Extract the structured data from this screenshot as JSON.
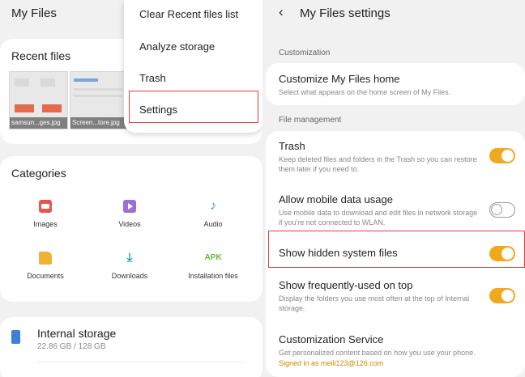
{
  "colors": {
    "accent": "#f2a81d",
    "highlight_box": "#d9403a",
    "link": "#c98a06"
  },
  "left": {
    "title": "My Files",
    "recent": {
      "title": "Recent files",
      "files": [
        "samsun...ges.jpg",
        "Screen...tore.jpg"
      ]
    },
    "menu": {
      "items": [
        "Clear Recent files list",
        "Analyze storage",
        "Trash",
        "Settings"
      ]
    },
    "categories": {
      "title": "Categories",
      "items": [
        {
          "label": "Images",
          "icon": "image-icon"
        },
        {
          "label": "Videos",
          "icon": "video-icon"
        },
        {
          "label": "Audio",
          "icon": "music-note-icon"
        },
        {
          "label": "Documents",
          "icon": "document-icon"
        },
        {
          "label": "Downloads",
          "icon": "download-icon"
        },
        {
          "label": "Installation files",
          "icon": "apk-icon",
          "icon_text": "APK"
        }
      ]
    },
    "storage": {
      "name": "Internal storage",
      "size": "22.86 GB / 128 GB"
    }
  },
  "right": {
    "title": "My Files settings",
    "sections": {
      "customization": "Customization",
      "file_management": "File management"
    },
    "customize_home": {
      "title": "Customize My Files home",
      "desc": "Select what appears on the home screen of My Files."
    },
    "trash": {
      "title": "Trash",
      "desc": "Keep deleted files and folders in the Trash so you can restore them later if you need to.",
      "enabled": true
    },
    "mobile_data": {
      "title": "Allow mobile data usage",
      "desc": "Use mobile data to download and edit files in network storage if you're not connected to WLAN.",
      "enabled": false
    },
    "hidden_files": {
      "title": "Show hidden system files",
      "enabled": true
    },
    "frequent": {
      "title": "Show frequently-used on top",
      "desc": "Display the folders you use most often at the top of Internal storage.",
      "enabled": true
    },
    "service": {
      "title": "Customization Service",
      "desc": "Get personalized content based on how you use your phone.",
      "account": "Signed in as meili123@126.com"
    }
  }
}
